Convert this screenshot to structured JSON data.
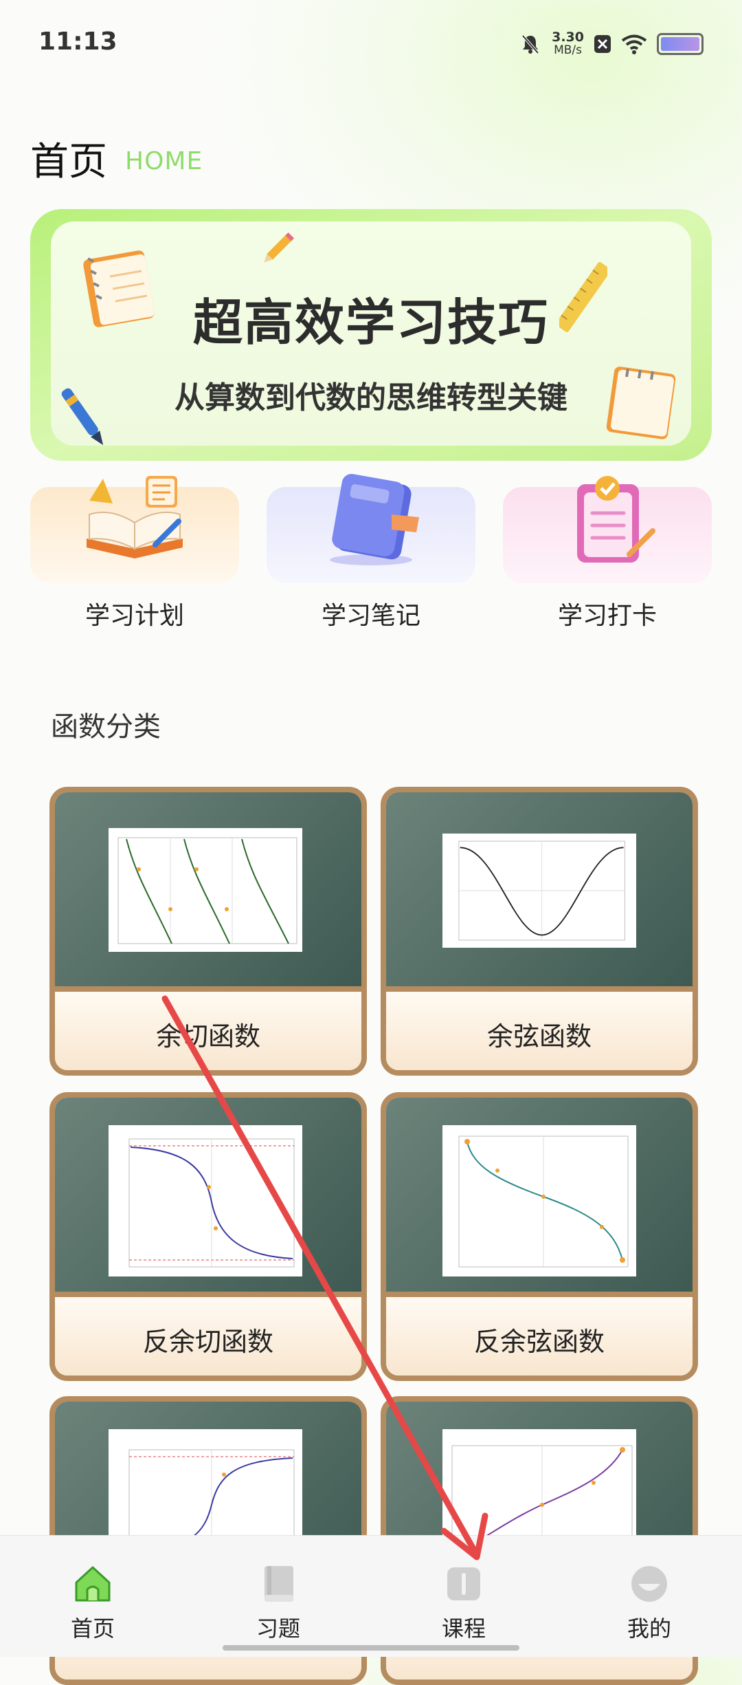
{
  "status_bar": {
    "time": "11:13",
    "net_speed": "3.30",
    "net_unit": "MB/s"
  },
  "header": {
    "title": "首页",
    "subtitle": "HOME"
  },
  "banner": {
    "title": "超高效学习技巧",
    "subtitle": "从算数到代数的思维转型关键"
  },
  "quick_actions": [
    {
      "label": "学习计划",
      "icon": "book-checklist-icon"
    },
    {
      "label": "学习笔记",
      "icon": "notebook-icon"
    },
    {
      "label": "学习打卡",
      "icon": "clipboard-check-icon"
    }
  ],
  "section": {
    "title": "函数分类"
  },
  "functions": [
    {
      "label": "余切函数"
    },
    {
      "label": "余弦函数"
    },
    {
      "label": "反余切函数"
    },
    {
      "label": "反余弦函数"
    },
    {
      "label": ""
    },
    {
      "label": ""
    }
  ],
  "bottom_nav": [
    {
      "label": "首页",
      "icon": "home-icon",
      "active": true
    },
    {
      "label": "习题",
      "icon": "book-icon",
      "active": false
    },
    {
      "label": "课程",
      "icon": "course-icon",
      "active": false
    },
    {
      "label": "我的",
      "icon": "profile-icon",
      "active": false
    }
  ],
  "colors": {
    "accent": "#8fdc6a",
    "card_border": "#b58c5f",
    "chalkboard": "#4e6b62",
    "arrow": "#e64848"
  }
}
